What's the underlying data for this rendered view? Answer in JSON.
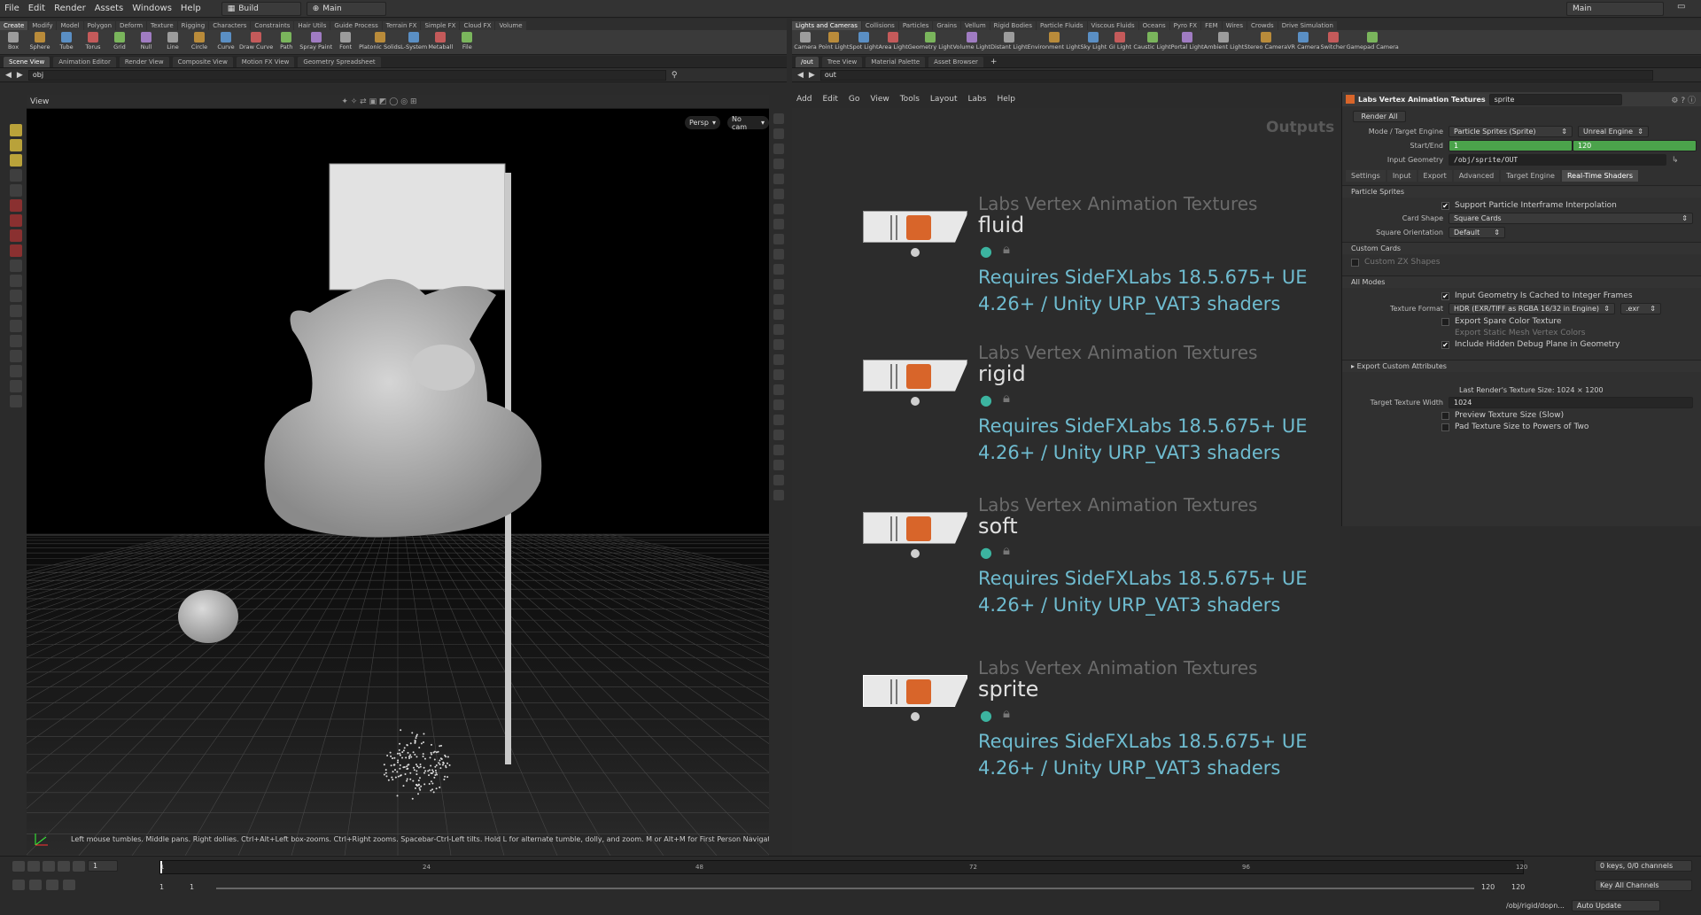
{
  "menubar": {
    "items": [
      "File",
      "Edit",
      "Render",
      "Assets",
      "Windows",
      "Help"
    ],
    "desktop": "Build",
    "context": "Main",
    "right_context": "Main"
  },
  "left_shelf": {
    "tabs": [
      "Create",
      "Modify",
      "Model",
      "Polygon",
      "Deform",
      "Texture",
      "Rigging",
      "Characters",
      "Constraints",
      "Hair Utils",
      "Guide Process",
      "Terrain FX",
      "Simple FX",
      "Cloud FX",
      "Volume"
    ],
    "tools": [
      "Box",
      "Sphere",
      "Tube",
      "Torus",
      "Grid",
      "Null",
      "Line",
      "Circle",
      "Curve",
      "Draw Curve",
      "Path",
      "Spray Paint",
      "Font",
      "Platonic Solids",
      "L-System",
      "Metaball",
      "File"
    ]
  },
  "right_shelf": {
    "tabs": [
      "Lights and Cameras",
      "Collisions",
      "Particles",
      "Grains",
      "Vellum",
      "Rigid Bodies",
      "Particle Fluids",
      "Viscous Fluids",
      "Oceans",
      "Pyro FX",
      "FEM",
      "Wires",
      "Crowds",
      "Drive Simulation"
    ],
    "tools": [
      "Camera",
      "Point Light",
      "Spot Light",
      "Area Light",
      "Geometry Light",
      "Volume Light",
      "Distant Light",
      "Environment Light",
      "Sky Light",
      "GI Light",
      "Caustic Light",
      "Portal Light",
      "Ambient Light",
      "Stereo Camera",
      "VR Camera",
      "Switcher",
      "Gamepad Camera"
    ]
  },
  "left_pane": {
    "tabs": [
      "Scene View",
      "Animation Editor",
      "Render View",
      "Composite View",
      "Motion FX View",
      "Geometry Spreadsheet"
    ],
    "path": "obj",
    "view_label": "View",
    "persp": "Persp",
    "cam": "No cam",
    "hint": "Left mouse tumbles. Middle pans. Right dollies. Ctrl+Alt+Left box-zooms. Ctrl+Right zooms. Spacebar-Ctrl-Left tilts. Hold L for alternate tumble, dolly, and zoom.    M or Alt+M for First Person Navigation."
  },
  "right_pane": {
    "path_tab": "/out",
    "tabs": [
      "Tree View",
      "Material Palette",
      "Asset Browser"
    ],
    "path": "out",
    "menu": [
      "Add",
      "Edit",
      "Go",
      "View",
      "Tools",
      "Layout",
      "Labs",
      "Help"
    ],
    "network_label": "Outputs",
    "nodes": [
      {
        "type": "Labs Vertex Animation Textures",
        "name": "fluid",
        "msg1": "Requires SideFXLabs 18.5.675+ UE",
        "msg2": "4.26+ / Unity URP_VAT3 shaders"
      },
      {
        "type": "Labs Vertex Animation Textures",
        "name": "rigid",
        "msg1": "Requires SideFXLabs 18.5.675+ UE",
        "msg2": "4.26+ / Unity URP_VAT3 shaders"
      },
      {
        "type": "Labs Vertex Animation Textures",
        "name": "soft",
        "msg1": "Requires SideFXLabs 18.5.675+ UE",
        "msg2": "4.26+ / Unity URP_VAT3 shaders"
      },
      {
        "type": "Labs Vertex Animation Textures",
        "name": "sprite",
        "msg1": "Requires SideFXLabs 18.5.675+ UE",
        "msg2": "4.26+ / Unity URP_VAT3 shaders"
      }
    ]
  },
  "params": {
    "node_type": "Labs Vertex Animation Textures",
    "node_name": "sprite",
    "render_all": "Render All",
    "mode_label": "Mode / Target Engine",
    "mode_value": "Particle Sprites (Sprite)",
    "engine_value": "Unreal Engine",
    "startend_label": "Start/End",
    "start": "1",
    "end": "120",
    "input_geo_label": "Input Geometry",
    "input_geo": "/obj/sprite/OUT",
    "tabs": [
      "Settings",
      "Input",
      "Export",
      "Advanced",
      "Target Engine",
      "Real-Time Shaders"
    ],
    "sec_particle": "Particle Sprites",
    "support_interp": "Support Particle Interframe Interpolation",
    "card_shape_label": "Card Shape",
    "card_shape": "Square Cards",
    "square_orient_label": "Square Orientation",
    "square_orient": "Default",
    "sec_custom_cards": "Custom Cards",
    "custom_zx": "Custom ZX Shapes",
    "sec_all_modes": "All Modes",
    "cached_int": "Input Geometry Is Cached to Integer Frames",
    "tex_format_label": "Texture Format",
    "tex_format": "HDR (EXR/TIFF as RGBA 16/32 in Engine)",
    "tex_ext": ".exr",
    "spare_color": "Export Spare Color Texture",
    "static_mesh": "Export Static Mesh Vertex Colors",
    "debug_plane": "Include Hidden Debug Plane in Geometry",
    "export_custom": "Export Custom Attributes",
    "last_render": "Last Render's Texture Size: 1024 × 1200",
    "target_width_label": "Target Texture Width",
    "target_width": "1024",
    "preview_size": "Preview Texture Size (Slow)",
    "pad_pow2": "Pad Texture Size to Powers of Two"
  },
  "timeline": {
    "frame": "1",
    "start": "1",
    "start2": "1",
    "end": "120",
    "end2": "120",
    "keys": "0 keys, 0/0 channels",
    "key_all": "Key All Channels",
    "status_path": "/obj/rigid/dopn...",
    "auto_update": "Auto Update",
    "ticks": [
      "1",
      "24",
      "48",
      "72",
      "96",
      "120"
    ]
  }
}
